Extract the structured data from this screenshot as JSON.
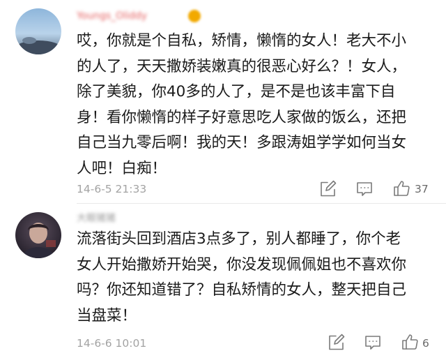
{
  "comments": [
    {
      "username": "Youngs_Oliddy",
      "text": "哎，你就是个自私，矫情，懒惰的女人！老大不小\n的人了，天天撒娇装嫩真的很恶心好么？！女人，\n除了美貌，你40多的人了，是不是也该丰富下自\n身！看你懒惰的样子好意思吃人家做的饭么，还把\n自己当九零后啊！我的天！多跟涛姐学学如何当女\n人吧！白痴！",
      "time": "14-6-5 21:33",
      "likes": "37"
    },
    {
      "username": "大眼猪猪",
      "text": "流落街头回到酒店3点多了，别人都睡了，你个老\n女人开始撒娇开始哭，你没发现佩佩姐也不喜欢你\n吗？你还知道错了？自私矫情的女人，整天把自己\n当盘菜！",
      "time": "14-6-6 10:01",
      "likes": "6"
    }
  ],
  "icons": {
    "repost": "edit-share-icon",
    "reply": "comment-bubble-icon",
    "like": "thumbs-up-icon"
  },
  "colors": {
    "text": "#1a1a1a",
    "meta": "#a3a3a3",
    "username_vip": "#e45f5f",
    "username": "#9a9a9a",
    "icon": "#7a7a7a"
  }
}
